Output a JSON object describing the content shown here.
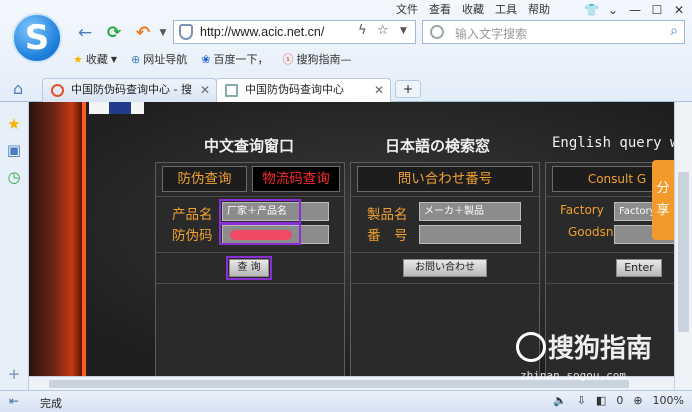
{
  "menu": [
    "文件",
    "查看",
    "收藏",
    "工具",
    "帮助"
  ],
  "window_buttons": [
    "⌄",
    "⇧",
    "—",
    "☐",
    "✕"
  ],
  "nav": {
    "back": "←",
    "refresh": "⟳",
    "undo": "↶"
  },
  "address": {
    "url": "http://www.acic.net.cn/"
  },
  "search": {
    "placeholder": "输入文字搜索"
  },
  "bookmarks": [
    {
      "label": "收藏",
      "icon": "star-icon"
    },
    {
      "label": "网址导航",
      "icon": "globe-icon"
    },
    {
      "label": "百度一下，",
      "icon": "paw-icon"
    },
    {
      "label": "搜狗指南—",
      "icon": "sogou-icon"
    }
  ],
  "tabs": [
    {
      "label": "中国防伪码查询中心 - 搜",
      "active": false
    },
    {
      "label": "中国防伪码查询中心",
      "active": true
    }
  ],
  "columns": {
    "cn": {
      "heading": "中文查询窗口",
      "tab1": "防伪查询",
      "tab2": "物流码查询",
      "label1": "产品名",
      "label2": "防伪码",
      "field1": "厂家＋产品名",
      "button": "查 询"
    },
    "jp": {
      "heading": "日本語の検索窓",
      "tab": "問い合わせ番号",
      "label1": "製品名",
      "label2": "番　号",
      "field1": "メーカ＋製品",
      "button": "お問い合わせ"
    },
    "en": {
      "heading": "English query w",
      "tab": "Consult G",
      "label1": "Factory",
      "label2": "Goodsn",
      "field1": "Factory",
      "button": "Enter"
    }
  },
  "share": "分享",
  "watermark": {
    "brand": "搜狗指南",
    "url": "zhinan.sogou.com"
  },
  "status": {
    "text": "完成",
    "zoom": "100%",
    "count": "0"
  }
}
